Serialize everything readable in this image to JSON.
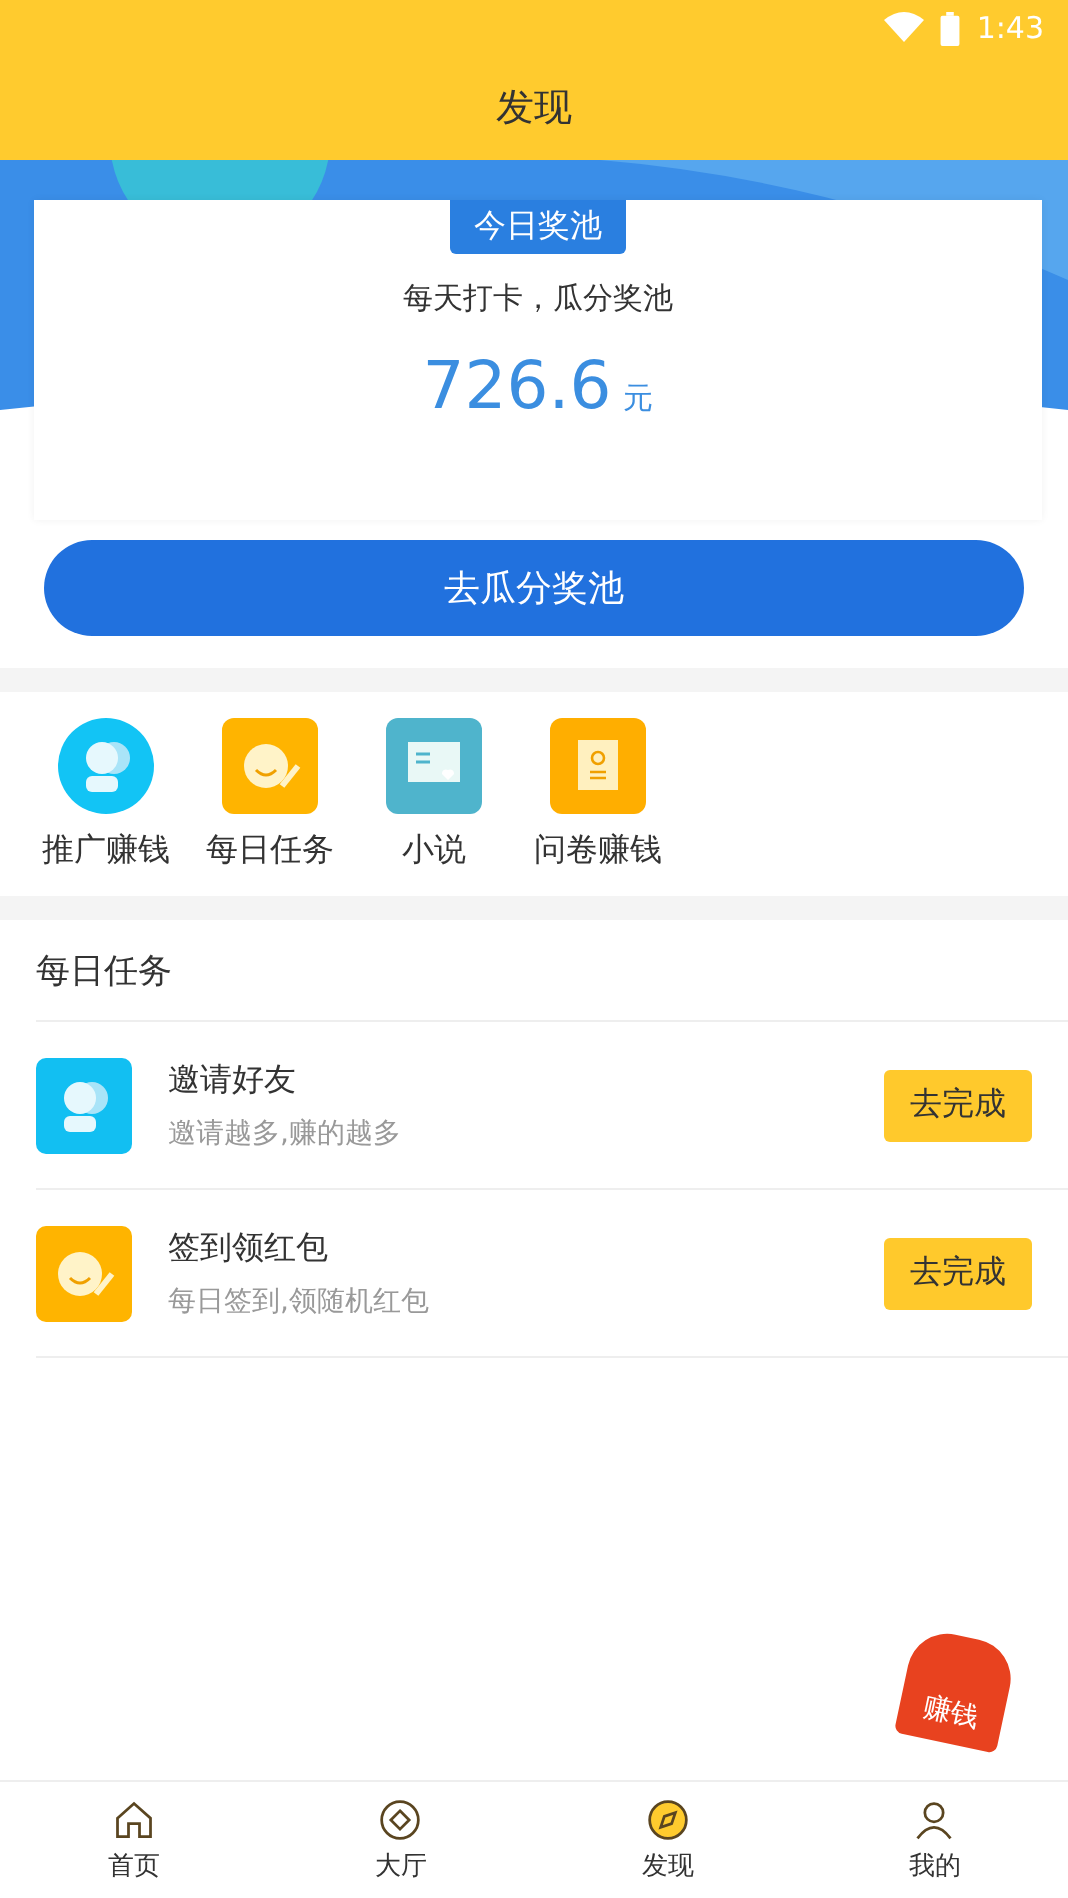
{
  "status_bar": {
    "time": "1:43"
  },
  "header": {
    "title": "发现"
  },
  "pool": {
    "badge": "今日奖池",
    "subtitle": "每天打卡，瓜分奖池",
    "amount": "726.6",
    "unit": "元",
    "button": "去瓜分奖池"
  },
  "shortcuts": [
    {
      "kind": "friends",
      "label": "推广赚钱"
    },
    {
      "kind": "smile",
      "label": "每日任务"
    },
    {
      "kind": "book",
      "label": "小说"
    },
    {
      "kind": "survey",
      "label": "问卷赚钱"
    }
  ],
  "tasks": {
    "title": "每日任务",
    "items": [
      {
        "kind": "friends",
        "title": "邀请好友",
        "subtitle": "邀请越多,赚的越多",
        "action": "去完成"
      },
      {
        "kind": "smile",
        "title": "签到领红包",
        "subtitle": "每日签到,领随机红包",
        "action": "去完成"
      }
    ]
  },
  "float_badge": {
    "label": "赚钱"
  },
  "tab_bar": [
    {
      "kind": "home",
      "label": "首页",
      "selected": false
    },
    {
      "kind": "hall",
      "label": "大厅",
      "selected": false
    },
    {
      "kind": "discover",
      "label": "发现",
      "selected": true
    },
    {
      "kind": "me",
      "label": "我的",
      "selected": false
    }
  ]
}
